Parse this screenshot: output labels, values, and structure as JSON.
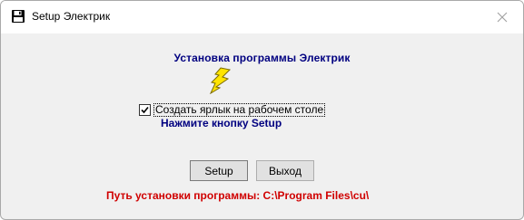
{
  "window": {
    "title": "Setup Электрик"
  },
  "main": {
    "heading": "Установка программы Электрик",
    "checkbox": {
      "label": "Создать ярлык на рабочем столе",
      "checked": true
    },
    "hint": "Нажмите кнопку Setup",
    "buttons": {
      "setup_label": "Setup",
      "exit_label": "Выход"
    },
    "install_path": "Путь установки программы: C:\\Program Files\\cu\\"
  },
  "colors": {
    "heading": "#000080",
    "path": "#d00000",
    "bolt": "#ffe400"
  },
  "icons": [
    "floppy-disk-icon",
    "close-icon",
    "lightning-bolt-icon",
    "checkmark-icon"
  ]
}
